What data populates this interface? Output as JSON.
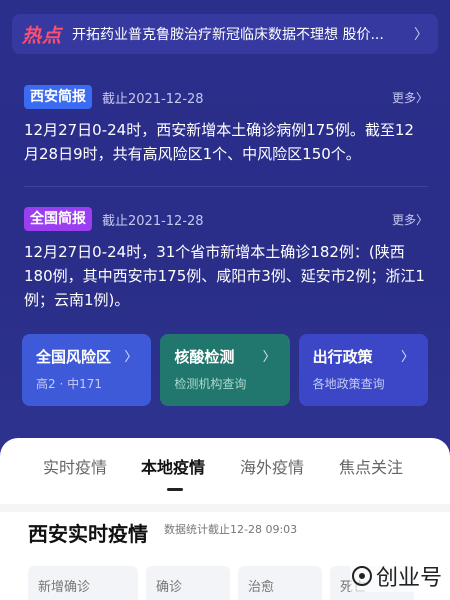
{
  "hot": {
    "tag": "热点",
    "text": "开拓药业普克鲁胺治疗新冠临床数据不理想 股价...",
    "chevron": "〉"
  },
  "xian_brief": {
    "tag": "西安简报",
    "date": "截止2021-12-28",
    "more": "更多〉",
    "body": "12月27日0-24时，西安新增本土确诊病例175例。截至12月28日9时，共有高风险区1个、中风险区150个。"
  },
  "national_brief": {
    "tag": "全国简报",
    "date": "截止2021-12-28",
    "more": "更多〉",
    "body": "12月27日0-24时，31个省市新增本土确诊182例：(陕西180例，其中西安市175例、咸阳市3例、延安市2例；浙江1例；云南1例)。"
  },
  "cards": [
    {
      "title": "全国风险区",
      "chevron": "〉",
      "sub": "高2 · 中171"
    },
    {
      "title": "核酸检测",
      "chevron": "〉",
      "sub": "检测机构查询"
    },
    {
      "title": "出行政策",
      "chevron": "〉",
      "sub": "各地政策查询"
    }
  ],
  "tabs": [
    "实时疫情",
    "本地疫情",
    "海外疫情",
    "焦点关注"
  ],
  "active_tab": "本地疫情",
  "section": {
    "title": "西安实时疫情",
    "stamp": "数据统计截止12-28 09:03"
  },
  "stats": [
    "新增确诊",
    "确诊",
    "治愈",
    "死亡"
  ],
  "watermark": "创业号",
  "colors": {
    "background": "#2a2e86",
    "hot_tag": "#ff4d6d",
    "tag_blue": "#3b6bf0",
    "tag_purple": "#9b3df0",
    "card_blue": "#3f5ad9",
    "card_green": "#21776e",
    "card_indigo": "#3c47c7"
  },
  "icons": [
    "chevron-right-icon",
    "watermark-logo-icon"
  ]
}
